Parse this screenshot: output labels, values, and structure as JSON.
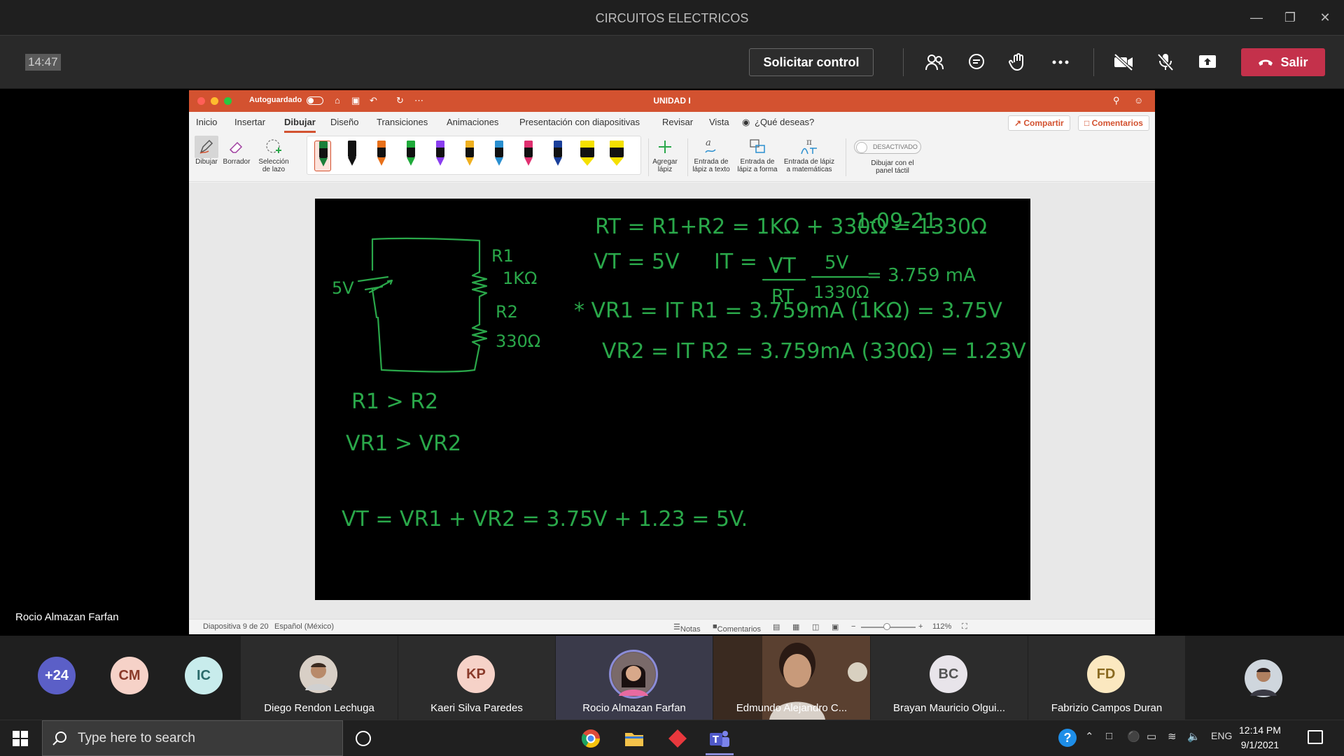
{
  "window": {
    "title": "CIRCUITOS ELECTRICOS",
    "minimize_icon": "minimize-icon",
    "restore_icon": "restore-icon",
    "close_icon": "close-icon"
  },
  "meeting": {
    "timer": "14:47",
    "request_control_label": "Solicitar control",
    "leave_label": "Salir",
    "leave_color": "#c4314b",
    "icons": [
      "people-icon",
      "chat-icon",
      "raise-hand-icon",
      "more-icon",
      "camera-off-icon",
      "mic-off-icon",
      "share-icon"
    ]
  },
  "presenter_name": "Rocio Almazan Farfan",
  "ppt": {
    "autosave_label": "Autoguardado",
    "doc_name": "UNIDAD I",
    "accent": "#d35230",
    "tabs": [
      "Inicio",
      "Insertar",
      "Dibujar",
      "Diseño",
      "Transiciones",
      "Animaciones",
      "Presentación con diapositivas",
      "Revisar",
      "Vista"
    ],
    "active_tab": "Dibujar",
    "tell_me": "¿Qué deseas?",
    "share_label": "Compartir",
    "comments_label": "Comentarios",
    "ribbon": {
      "draw_label": "Dibujar",
      "eraser_label": "Borrador",
      "lasso_label_1": "Selección",
      "lasso_label_2": "de lazo",
      "add_pen_label_1": "Agregar",
      "add_pen_label_2": "lápiz",
      "ink_text_1": "Entrada de",
      "ink_text_2": "lápiz a texto",
      "ink_shape_1": "Entrada de",
      "ink_shape_2": "lápiz a forma",
      "ink_math_1": "Entrada de lápiz",
      "ink_math_2": "a matemáticas",
      "touch_toggle": "DESACTIVADO",
      "touch_label_1": "Dibujar con el",
      "touch_label_2": "panel táctil",
      "pen_colors": [
        "#1a7f3a",
        "#111111",
        "#e8701a",
        "#1faa3a",
        "#8a3ef0",
        "#f0b020",
        "#2a8fd0",
        "#e03070",
        "#1a3f9a",
        "#f5e000",
        "#f5e000"
      ]
    },
    "slide": {
      "date": "1-09-21",
      "eq_rt": "RT = R1+R2 = 1KΩ + 330Ω = 1330Ω",
      "eq_vt": "VT = 5V",
      "eq_it_lhs": "IT =",
      "eq_it_num": "VT",
      "eq_it_den": "RT",
      "eq_it_num2": "5V",
      "eq_it_den2": "1330Ω",
      "eq_it_res": "= 3.759 mA",
      "eq_vr1": "* VR1 = IT R1 = 3.759mA (1KΩ) = 3.75V",
      "eq_vr2": "VR2 = IT R2 = 3.759mA (330Ω) = 1.23V",
      "src": "5V",
      "r1": "R1",
      "r1_val": "1KΩ",
      "r2": "R2",
      "r2_val": "330Ω",
      "cmp1": "R1 > R2",
      "cmp2": "VR1 > VR2",
      "sum": "VT = VR1 + VR2 = 3.75V + 1.23 = 5V.",
      "ink_color": "#2aa84a"
    },
    "status": {
      "slide_counter": "Diapositiva 9 de 20",
      "language": "Español (México)",
      "notes": "Notas",
      "comments": "Comentarios",
      "zoom": "112%"
    }
  },
  "participants": {
    "overflow": "+24",
    "avatars": [
      {
        "initials": "CM",
        "bg": "#f6d2c8",
        "fg": "#8a3a2a"
      },
      {
        "initials": "IC",
        "bg": "#c8ecec",
        "fg": "#2a6a6a"
      }
    ],
    "tiles": [
      {
        "name": "Diego Rendon Lechuga",
        "kind": "photo"
      },
      {
        "name": "Kaeri Silva Paredes",
        "kind": "initials",
        "initials": "KP",
        "bg": "#f6d2c8",
        "fg": "#8a3a2a"
      },
      {
        "name": "Rocio Almazan Farfan",
        "kind": "photo"
      },
      {
        "name": "Edmundo Alejandro C...",
        "kind": "video"
      },
      {
        "name": "Brayan Mauricio Olgui...",
        "kind": "initials",
        "initials": "BC",
        "bg": "#e8e4ea",
        "fg": "#555"
      },
      {
        "name": "Fabrizio Campos Duran",
        "kind": "initials",
        "initials": "FD",
        "bg": "#fbe8c0",
        "fg": "#8a6a20"
      }
    ]
  },
  "taskbar": {
    "search_placeholder": "Type here to search",
    "lang": "ENG",
    "time": "12:14 PM",
    "date": "9/1/2021"
  }
}
